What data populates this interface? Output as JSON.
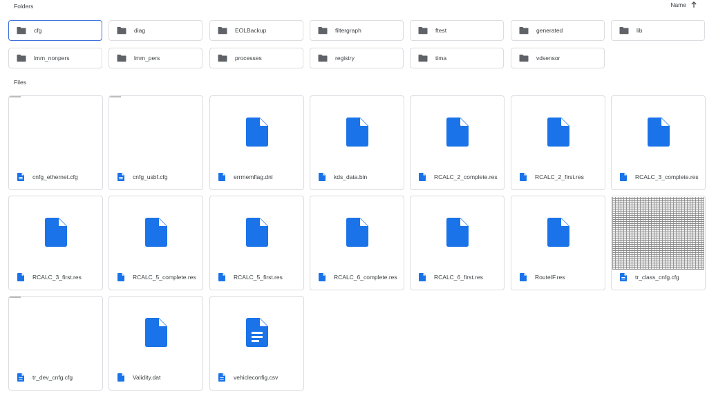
{
  "headers": {
    "folders": "Folders",
    "files": "Files",
    "sort_label": "Name"
  },
  "colors": {
    "folder_icon": "#5f6368",
    "file_icon": "#1a73e8",
    "selected_border": "#3a6fd8"
  },
  "folders": [
    {
      "label": "cfg",
      "selected": true
    },
    {
      "label": "diag"
    },
    {
      "label": "EOLBackup"
    },
    {
      "label": "filtergraph"
    },
    {
      "label": "ftest"
    },
    {
      "label": "generated"
    },
    {
      "label": "lib"
    },
    {
      "label": "lmm_nonpers"
    },
    {
      "label": "lmm_pers"
    },
    {
      "label": "processes"
    },
    {
      "label": "registry"
    },
    {
      "label": "tima"
    },
    {
      "label": "vdsensor"
    }
  ],
  "files": [
    {
      "name": "cnfg_ethernet.cfg",
      "icon": "doc-lines-icon",
      "preview": "blank"
    },
    {
      "name": "cnfg_usbf.cfg",
      "icon": "doc-lines-icon",
      "preview": "blank"
    },
    {
      "name": "errmemflag.dnl",
      "icon": "file-icon",
      "preview": "generic-file"
    },
    {
      "name": "kds_data.bin",
      "icon": "file-icon",
      "preview": "generic-file"
    },
    {
      "name": "RCALC_2_complete.res",
      "icon": "file-icon",
      "preview": "generic-file"
    },
    {
      "name": "RCALC_2_first.res",
      "icon": "file-icon",
      "preview": "generic-file"
    },
    {
      "name": "RCALC_3_complete.res",
      "icon": "file-icon",
      "preview": "generic-file"
    },
    {
      "name": "RCALC_3_first.res",
      "icon": "file-icon",
      "preview": "generic-file"
    },
    {
      "name": "RCALC_5_complete.res",
      "icon": "file-icon",
      "preview": "generic-file"
    },
    {
      "name": "RCALC_5_first.res",
      "icon": "file-icon",
      "preview": "generic-file"
    },
    {
      "name": "RCALC_6_complete.res",
      "icon": "file-icon",
      "preview": "generic-file"
    },
    {
      "name": "RCALC_6_first.res",
      "icon": "file-icon",
      "preview": "generic-file"
    },
    {
      "name": "RouteIF.res",
      "icon": "file-icon",
      "preview": "generic-file"
    },
    {
      "name": "tr_class_cnfg.cfg",
      "icon": "doc-lines-icon",
      "preview": "text-grid"
    },
    {
      "name": "tr_dev_cnfg.cfg",
      "icon": "doc-lines-icon",
      "preview": "blank"
    },
    {
      "name": "Validity.dat",
      "icon": "file-icon",
      "preview": "generic-file"
    },
    {
      "name": "vehicleconfig.csv",
      "icon": "doc-lines-icon",
      "preview": "spreadsheet-file"
    }
  ]
}
